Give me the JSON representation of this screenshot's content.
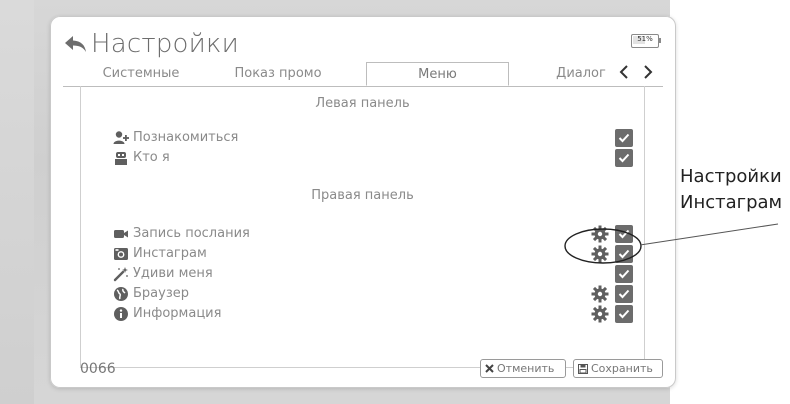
{
  "title": "Настройки",
  "battery": {
    "label": "51%",
    "level_percent": 51
  },
  "tabs": [
    {
      "label": "Системные",
      "active": false
    },
    {
      "label": "Показ промо",
      "active": false
    },
    {
      "label": "Меню",
      "active": true
    },
    {
      "label": "Диалог",
      "active": false
    }
  ],
  "sections": {
    "left": {
      "title": "Левая панель",
      "items": [
        {
          "label": "Познакомиться",
          "icon": "add-user-icon",
          "checked": true,
          "has_settings": false
        },
        {
          "label": "Кто я",
          "icon": "robot-icon",
          "checked": true,
          "has_settings": false
        }
      ]
    },
    "right": {
      "title": "Правая панель",
      "items": [
        {
          "label": "Запись послания",
          "icon": "video-camera-icon",
          "checked": true,
          "has_settings": true
        },
        {
          "label": "Инстаграм",
          "icon": "camera-icon",
          "checked": true,
          "has_settings": true
        },
        {
          "label": "Удиви меня",
          "icon": "magic-wand-icon",
          "checked": true,
          "has_settings": false
        },
        {
          "label": "Браузер",
          "icon": "globe-icon",
          "checked": true,
          "has_settings": true
        },
        {
          "label": "Информация",
          "icon": "info-icon",
          "checked": true,
          "has_settings": true
        }
      ]
    }
  },
  "footer": {
    "code": "0066",
    "cancel_label": "Отменить",
    "save_label": "Сохранить"
  },
  "annotation": {
    "line1": "Настройки",
    "line2": "Инстаграм"
  },
  "colors": {
    "checkbox": "#6c6c6c",
    "text": "#8a8a8a",
    "icon": "#5f5f5f"
  }
}
